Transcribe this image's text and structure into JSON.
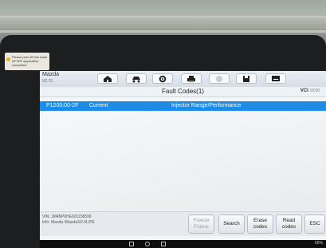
{
  "sticker": {
    "text": "Please peel off this mask AFTER application completed"
  },
  "header": {
    "brand": "Mazda",
    "version": "V2.70"
  },
  "toolbar": {
    "icons": [
      "home-icon",
      "car-icon",
      "gear-icon",
      "printer-icon",
      "record-icon",
      "save-icon",
      "keyboard-icon"
    ]
  },
  "title": {
    "text": "Fault Codes(1)",
    "vci_label": "VCI",
    "vci_small": "19:50"
  },
  "fault_rows": [
    {
      "code": "P1200:00-2F",
      "status": "Current",
      "description": "Injector Range/Performance"
    }
  ],
  "footer": {
    "vin_line1": "VIN: JM4BP6HE601158596",
    "vin_line2": "Info: Mazda /Mazda3/2.0L/PE"
  },
  "buttons": {
    "freeze_frame": "Freeze Frame",
    "search": "Search",
    "erase_codes": "Erase codes",
    "read_codes": "Read codes",
    "esc": "ESC"
  },
  "system_bar": {
    "right_text": "65%"
  },
  "colors": {
    "accent": "#1f8be3",
    "bezel": "#1d1e1f"
  }
}
